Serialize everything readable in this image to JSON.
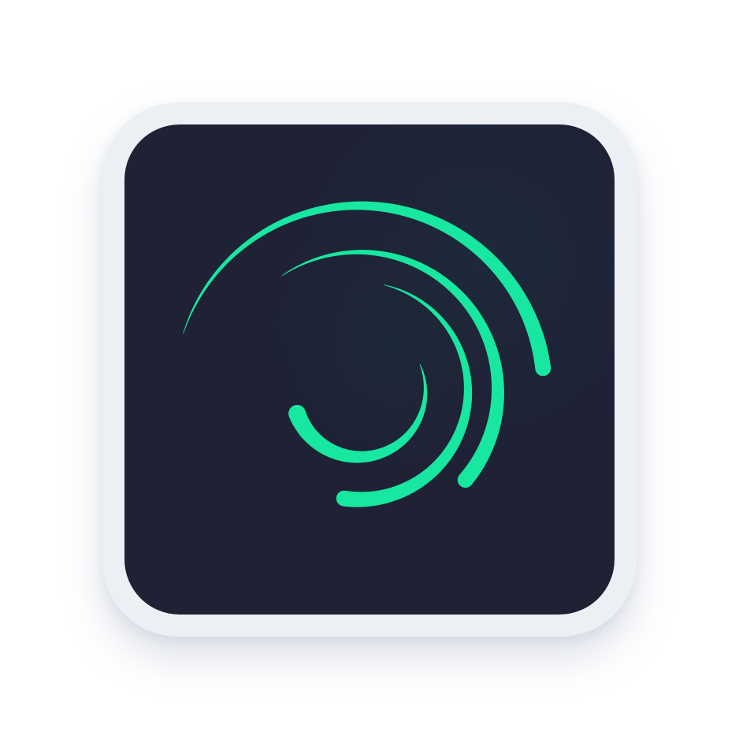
{
  "app_icon": {
    "icon_name": "alight-motion-swirl-icon",
    "colors": {
      "page_background": "#ffffff",
      "frame": "#eceff3",
      "tile": "#1f2135",
      "tile_highlight": "#1d2b3c",
      "swirl": "#17e7a0"
    }
  }
}
